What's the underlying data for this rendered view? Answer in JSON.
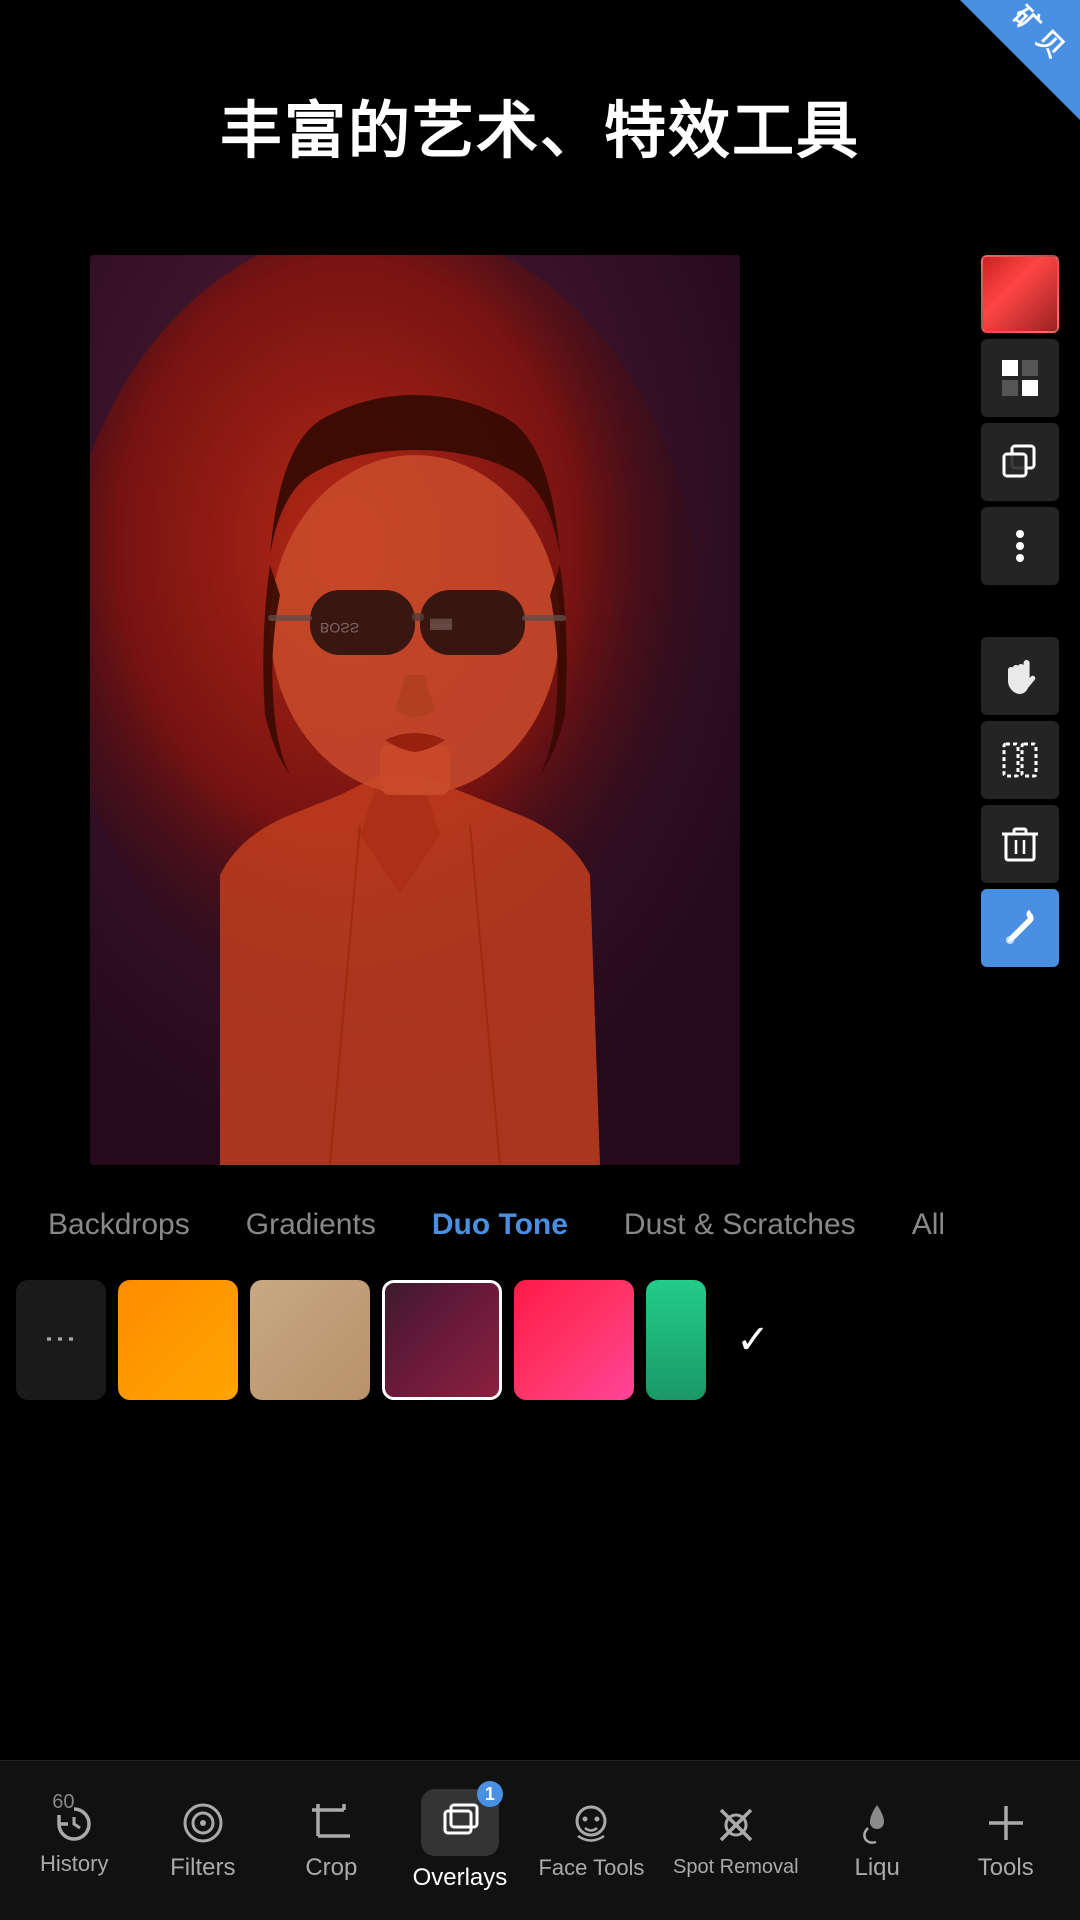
{
  "app": {
    "title": "丰富的艺术、特效工具",
    "badge_text": "矿\n贝",
    "badge_color": "#4a90e2"
  },
  "toolbar": {
    "color_swatch": "red-gradient",
    "buttons": [
      "checkerboard",
      "duplicate",
      "more"
    ]
  },
  "categories": {
    "items": [
      {
        "id": "backdrops",
        "label": "Backdrops",
        "active": false
      },
      {
        "id": "gradients",
        "label": "Gradients",
        "active": false
      },
      {
        "id": "duo-tone",
        "label": "Duo Tone",
        "active": true
      },
      {
        "id": "dust-scratches",
        "label": "Dust & Scratches",
        "active": false
      },
      {
        "id": "all",
        "label": "All",
        "active": false
      }
    ]
  },
  "swatches": {
    "items": [
      {
        "id": "menu",
        "type": "menu"
      },
      {
        "id": "orange",
        "type": "color",
        "gradient": "orange"
      },
      {
        "id": "tan",
        "type": "color",
        "gradient": "tan"
      },
      {
        "id": "dark-red",
        "type": "color",
        "gradient": "dark-red"
      },
      {
        "id": "pink-red",
        "type": "color",
        "gradient": "pink-red"
      }
    ]
  },
  "bottom_nav": {
    "items": [
      {
        "id": "history",
        "label": "History",
        "icon": "history",
        "count": "60",
        "active": false
      },
      {
        "id": "filters",
        "label": "Filters",
        "icon": "filters",
        "active": false
      },
      {
        "id": "crop",
        "label": "Crop",
        "icon": "crop",
        "active": false
      },
      {
        "id": "overlays",
        "label": "Overlays",
        "icon": "overlays",
        "active": true,
        "badge": "1"
      },
      {
        "id": "face-tools",
        "label": "Face Tools",
        "icon": "face",
        "active": false
      },
      {
        "id": "spot-removal",
        "label": "Spot Removal",
        "icon": "spot",
        "active": false
      },
      {
        "id": "liqu",
        "label": "Liqu",
        "icon": "liqu",
        "active": false
      },
      {
        "id": "tools",
        "label": "Tools",
        "icon": "plus",
        "active": false
      }
    ]
  }
}
